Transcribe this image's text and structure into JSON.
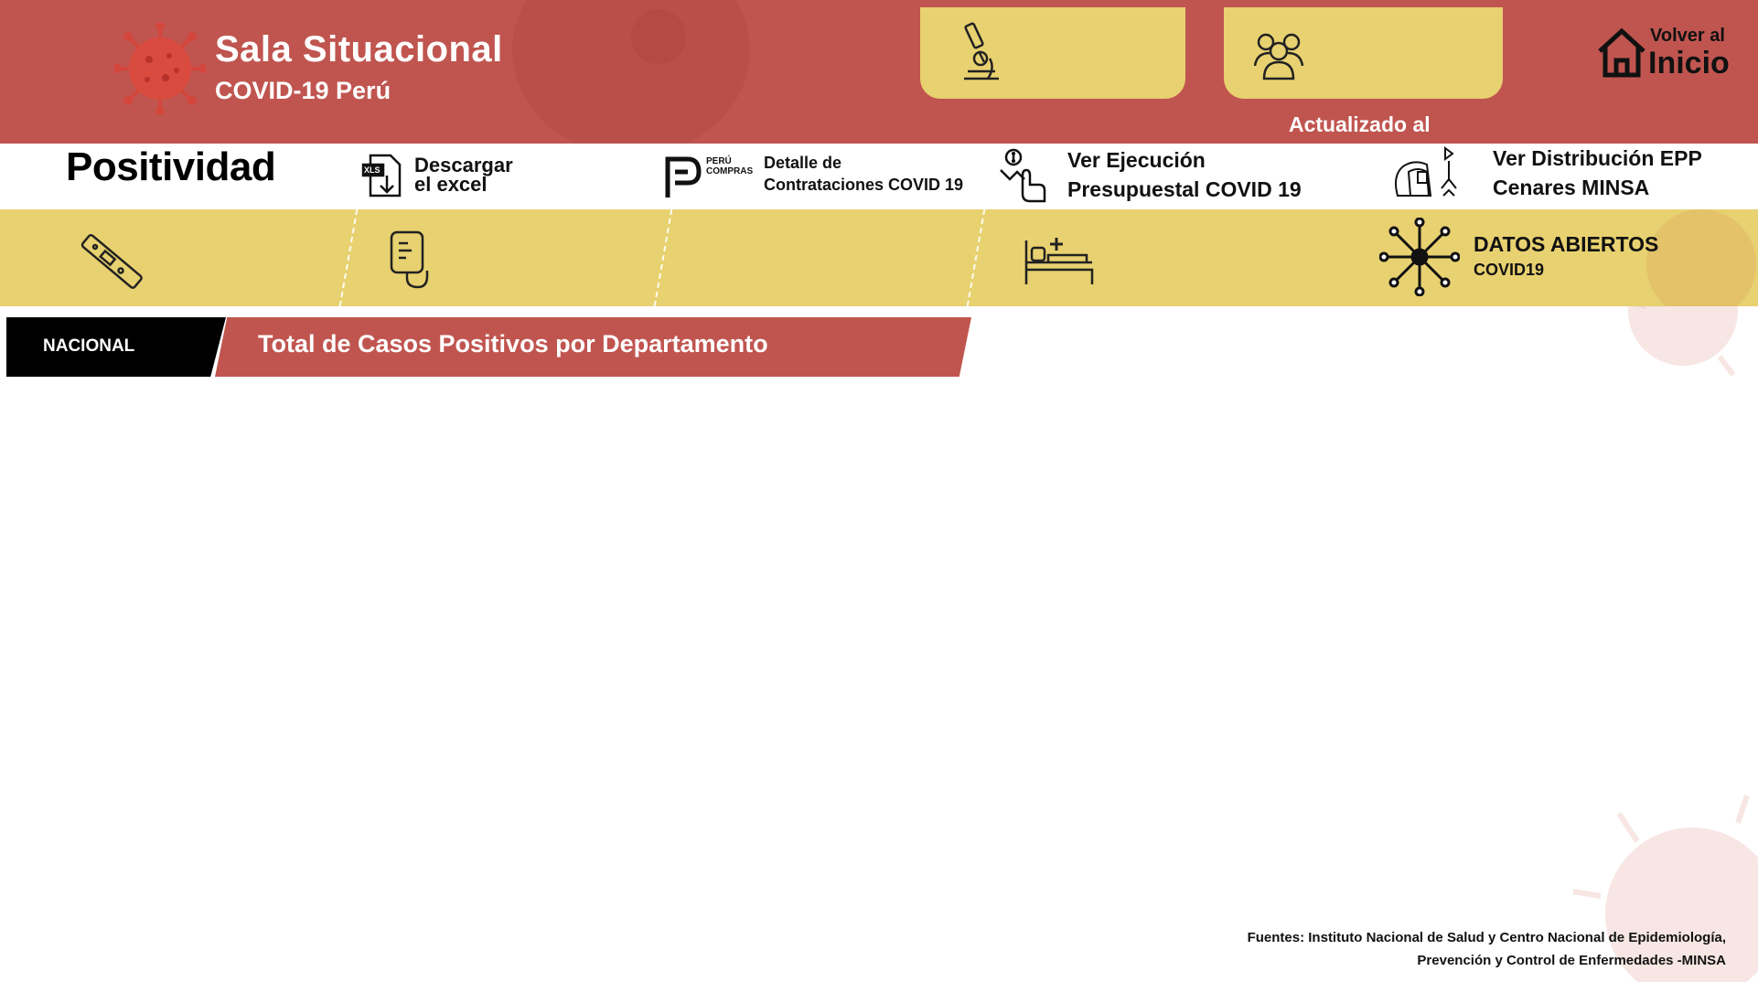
{
  "header": {
    "title": "Sala Situacional",
    "subtitle": "COVID-19 Perú",
    "updated_label": "Actualizado al",
    "home": {
      "line1": "Volver al",
      "line2": "Inicio"
    },
    "cards": [
      {
        "icon": "microscope-icon"
      },
      {
        "icon": "people-group-icon"
      }
    ]
  },
  "page": {
    "title": "Positividad"
  },
  "links": {
    "download": {
      "line1": "Descargar",
      "line2": "el excel",
      "icon": "xls-download-icon"
    },
    "compras": {
      "logo_line1": "PERÚ",
      "logo_line2": "COMPRAS",
      "line1": "Detalle  de",
      "line2": "Contrataciones COVID 19",
      "icon": "peru-compras-logo"
    },
    "ejecucion": {
      "line1": "Ver Ejecución",
      "line2": "Presupuestal COVID 19",
      "icon": "budget-hand-icon"
    },
    "epp": {
      "line1": "Ver Distribución EPP",
      "line2": "Cenares MINSA",
      "icon": "ppe-equipment-icon"
    }
  },
  "nav": {
    "items": [
      {
        "icon": "rapid-test-icon"
      },
      {
        "icon": "iv-bag-icon"
      },
      {
        "icon": "hospital-bed-icon"
      }
    ],
    "open_data": {
      "title": "DATOS ABIERTOS",
      "subtitle": "COVID19",
      "icon": "network-hub-icon"
    }
  },
  "section": {
    "scope": "NACIONAL",
    "title": "Total de Casos Positivos por Departamento"
  },
  "footer": {
    "sources_line1": "Fuentes: Instituto Nacional de Salud y Centro Nacional de Epidemiología,",
    "sources_line2": "Prevención y Control de Enfermedades -MINSA"
  },
  "colors": {
    "header_red": "#c0554f",
    "accent_yellow": "#e8d170",
    "virus_red": "#d4463c"
  }
}
